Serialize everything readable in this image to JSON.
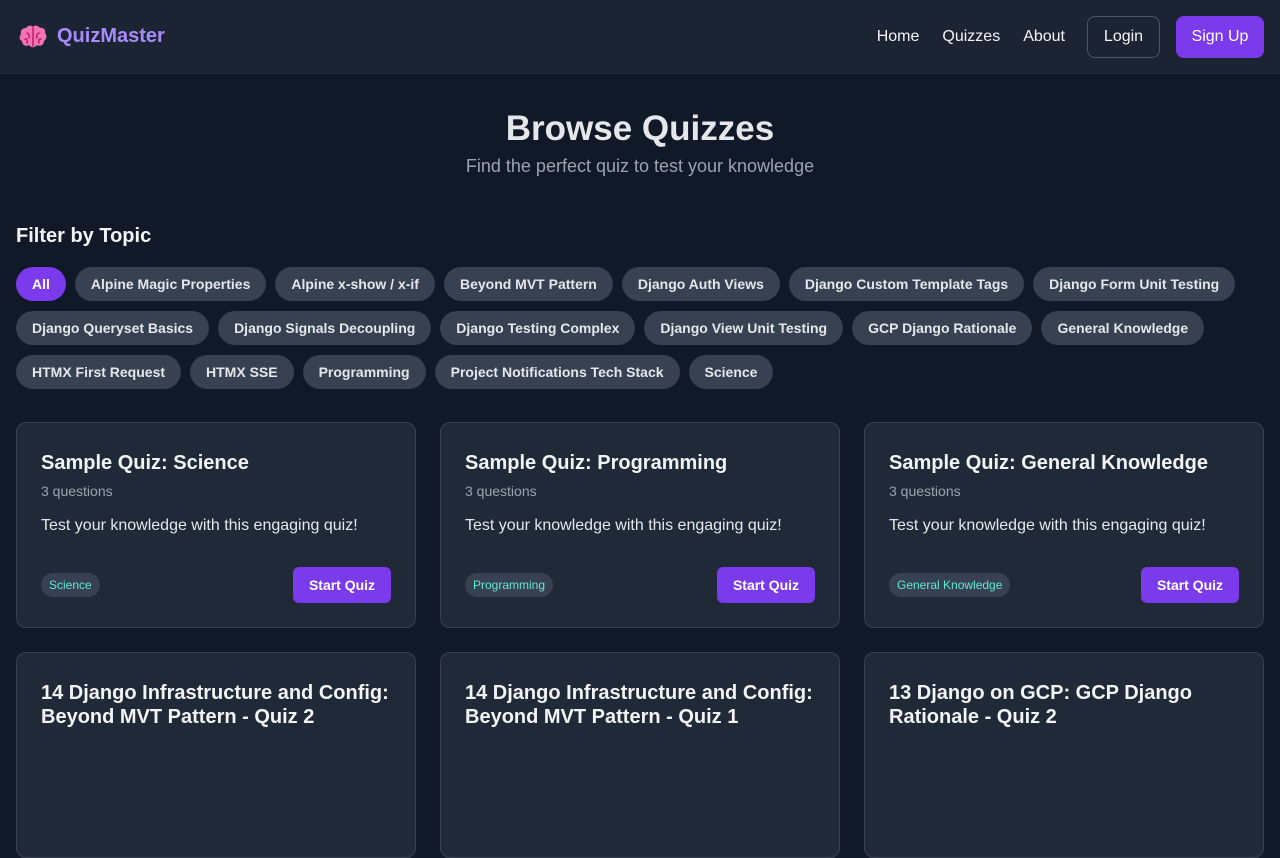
{
  "nav": {
    "brand": "QuizMaster",
    "brand_icon": "brain-icon",
    "links": [
      "Home",
      "Quizzes",
      "About"
    ],
    "login": "Login",
    "signup": "Sign Up"
  },
  "hero": {
    "title": "Browse Quizzes",
    "subtitle": "Find the perfect quiz to test your knowledge"
  },
  "filters": {
    "title": "Filter by Topic",
    "active": "All",
    "topics": [
      "All",
      "Alpine Magic Properties",
      "Alpine x-show / x-if",
      "Beyond MVT Pattern",
      "Django Auth Views",
      "Django Custom Template Tags",
      "Django Form Unit Testing",
      "Django Queryset Basics",
      "Django Signals Decoupling",
      "Django Testing Complex",
      "Django View Unit Testing",
      "GCP Django Rationale",
      "General Knowledge",
      "HTMX First Request",
      "HTMX SSE",
      "Programming",
      "Project Notifications Tech Stack",
      "Science"
    ]
  },
  "quizzes": [
    {
      "title": "Sample Quiz: Science",
      "count": "3 questions",
      "desc": "Test your knowledge with this engaging quiz!",
      "tag": "Science",
      "action": "Start Quiz"
    },
    {
      "title": "Sample Quiz: Programming",
      "count": "3 questions",
      "desc": "Test your knowledge with this engaging quiz!",
      "tag": "Programming",
      "action": "Start Quiz"
    },
    {
      "title": "Sample Quiz: General Knowledge",
      "count": "3 questions",
      "desc": "Test your knowledge with this engaging quiz!",
      "tag": "General Knowledge",
      "action": "Start Quiz"
    },
    {
      "title": "14 Django Infrastructure and Config: Beyond MVT Pattern - Quiz 2"
    },
    {
      "title": "14 Django Infrastructure and Config: Beyond MVT Pattern - Quiz 1"
    },
    {
      "title": "13 Django on GCP: GCP Django Rationale - Quiz 2"
    }
  ],
  "colors": {
    "background": "#111827",
    "navbar": "#1c2333",
    "card": "#1f2937",
    "accent": "#7c3aed",
    "brand_text": "#a78bfa",
    "chip": "#374151",
    "tag_text": "#5eead4"
  }
}
